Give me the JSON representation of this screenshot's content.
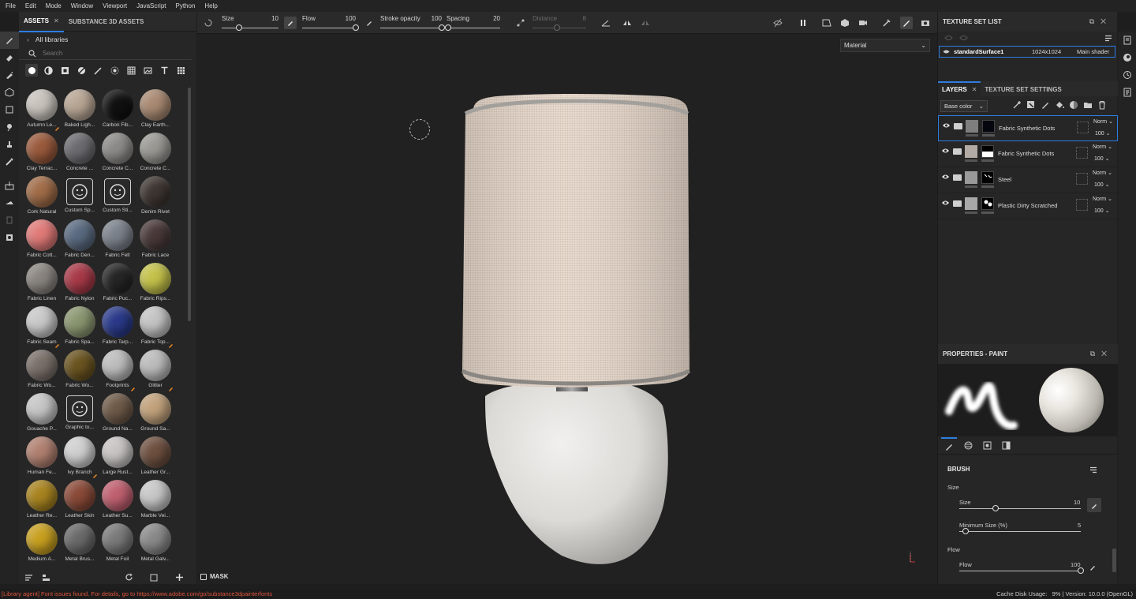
{
  "menu": [
    "File",
    "Edit",
    "Mode",
    "Window",
    "Viewport",
    "JavaScript",
    "Python",
    "Help"
  ],
  "assets": {
    "tabs": [
      "ASSETS",
      "SUBSTANCE 3D ASSETS"
    ],
    "library": "All libraries",
    "search_placeholder": "Search",
    "items": [
      {
        "label": "Autumn Le...",
        "color": "#c9c3bd",
        "badge": true
      },
      {
        "label": "Baked Ligh...",
        "color": "#b8a694",
        "badge": false
      },
      {
        "label": "Carbon Fib...",
        "color": "#111111",
        "badge": false
      },
      {
        "label": "Clay Earth...",
        "color": "#a98a72",
        "badge": false
      },
      {
        "label": "Clay Terrac...",
        "color": "#9a5a3c",
        "badge": false
      },
      {
        "label": "Concrete ...",
        "color": "#6c6c70",
        "badge": false
      },
      {
        "label": "Concrete C...",
        "color": "#8d8b88",
        "badge": false
      },
      {
        "label": "Concrete C...",
        "color": "#9a9994",
        "badge": false
      },
      {
        "label": "Cork Natural",
        "color": "#a06c48",
        "badge": false
      },
      {
        "label": "Custom Sp...",
        "color": "flat",
        "badge": false
      },
      {
        "label": "Custom Sti...",
        "color": "flat",
        "badge": false
      },
      {
        "label": "Denim Rivet",
        "color": "#3e3632",
        "badge": false
      },
      {
        "label": "Fabric Cott...",
        "color": "#e07a78",
        "badge": false
      },
      {
        "label": "Fabric Den...",
        "color": "#5a6a80",
        "badge": false
      },
      {
        "label": "Fabric Felt",
        "color": "#7c828c",
        "badge": false
      },
      {
        "label": "Fabric Lace",
        "color": "#4a3a3a",
        "badge": false
      },
      {
        "label": "Fabric Linen",
        "color": "#8a8580",
        "badge": false
      },
      {
        "label": "Fabric Nylon",
        "color": "#a83a48",
        "badge": false
      },
      {
        "label": "Fabric Puc...",
        "color": "#262626",
        "badge": false
      },
      {
        "label": "Fabric Rips...",
        "color": "#c4c24a",
        "badge": false
      },
      {
        "label": "Fabric Seam",
        "color": "#c9c9c9",
        "badge": true
      },
      {
        "label": "Fabric Spa...",
        "color": "#8a9670",
        "badge": false
      },
      {
        "label": "Fabric Tarp...",
        "color": "#2a3a8a",
        "badge": false
      },
      {
        "label": "Fabric Top...",
        "color": "#c4c4c4",
        "badge": true
      },
      {
        "label": "Fabric Wo...",
        "color": "#7a706a",
        "badge": false
      },
      {
        "label": "Fabric Wo...",
        "color": "#6a5420",
        "badge": false
      },
      {
        "label": "Footprints",
        "color": "#bdbdbd",
        "badge": true
      },
      {
        "label": "Glitter",
        "color": "#bcbcbc",
        "badge": true
      },
      {
        "label": "Gouache P...",
        "color": "#c6c6c6",
        "badge": false
      },
      {
        "label": "Graphic to...",
        "color": "flat",
        "badge": false
      },
      {
        "label": "Ground Na...",
        "color": "#6e5a48",
        "badge": false
      },
      {
        "label": "Ground Sa...",
        "color": "#c2a27c",
        "badge": false
      },
      {
        "label": "Human Fe...",
        "color": "#b08070",
        "badge": false
      },
      {
        "label": "Ivy Branch",
        "color": "#d0d0d0",
        "badge": true
      },
      {
        "label": "Large Rust...",
        "color": "#c8c4c4",
        "badge": false
      },
      {
        "label": "Leather Gr...",
        "color": "#6e5040",
        "badge": false
      },
      {
        "label": "Leather Re...",
        "color": "#a88420",
        "badge": false
      },
      {
        "label": "Leather Skin",
        "color": "#8a4a38",
        "badge": false
      },
      {
        "label": "Leather Su...",
        "color": "#c06070",
        "badge": false
      },
      {
        "label": "Marble Vei...",
        "color": "#c8c8c8",
        "badge": false
      },
      {
        "label": "Medium A...",
        "color": "#c8a020",
        "badge": false
      },
      {
        "label": "Metal Brus...",
        "color": "#6a6a6a",
        "badge": false
      },
      {
        "label": "Metal Foil",
        "color": "#7a7a7a",
        "badge": false
      },
      {
        "label": "Metal Galv...",
        "color": "#8a8a8a",
        "badge": false
      }
    ]
  },
  "toolbar": {
    "size": {
      "label": "Size",
      "value": "10",
      "frac": 0.3
    },
    "flow": {
      "label": "Flow",
      "value": "100",
      "frac": 1.0
    },
    "stroke_opacity": {
      "label": "Stroke opacity",
      "value": "100",
      "frac": 1.0
    },
    "spacing": {
      "label": "Spacing",
      "value": "20",
      "frac": 0.03
    },
    "distance": {
      "label": "Distance",
      "value": "8",
      "frac": 0.45
    }
  },
  "viewport": {
    "material_mode": "Material",
    "mask_label": "MASK"
  },
  "texture_set_list": {
    "title": "TEXTURE SET LIST",
    "row": {
      "name": "standardSurface1",
      "resolution": "1024x1024",
      "shader": "Main shader"
    }
  },
  "layers": {
    "tabs": [
      "LAYERS",
      "TEXTURE SET SETTINGS"
    ],
    "channel": "Base color",
    "items": [
      {
        "name": "Fabric Synthetic Dots",
        "blend": "Norm",
        "opacity": "100",
        "selected": true,
        "thumb": "#7e7e7e",
        "mask": "dark"
      },
      {
        "name": "Fabric Synthetic Dots",
        "blend": "Norm",
        "opacity": "100",
        "selected": false,
        "thumb": "#b2aaa4",
        "mask": "half"
      },
      {
        "name": "Steel",
        "blend": "Norm",
        "opacity": "100",
        "selected": false,
        "thumb": "#9a9a9a",
        "mask": "mark"
      },
      {
        "name": "Plastic Dirty Scratched",
        "blend": "Norm",
        "opacity": "100",
        "selected": false,
        "thumb": "#a8a8a8",
        "mask": "dots"
      }
    ]
  },
  "properties": {
    "title": "PROPERTIES - PAINT",
    "section": "BRUSH",
    "size_group": "Size",
    "size": {
      "label": "Size",
      "value": "10",
      "frac": 0.3
    },
    "min_size": {
      "label": "Minimum Size (%)",
      "value": "5",
      "frac": 0.05
    },
    "flow_group": "Flow",
    "flow": {
      "label": "Flow",
      "value": "100",
      "frac": 1.0
    }
  },
  "status": {
    "error": "[Library agent] Font issues found. For details, go to https://www.adobe.com/go/substance3dpainterfonts",
    "cache_label": "Cache Disk Usage:",
    "cache_value": "9%",
    "version": "Version: 10.0.0 (OpenGL)"
  }
}
